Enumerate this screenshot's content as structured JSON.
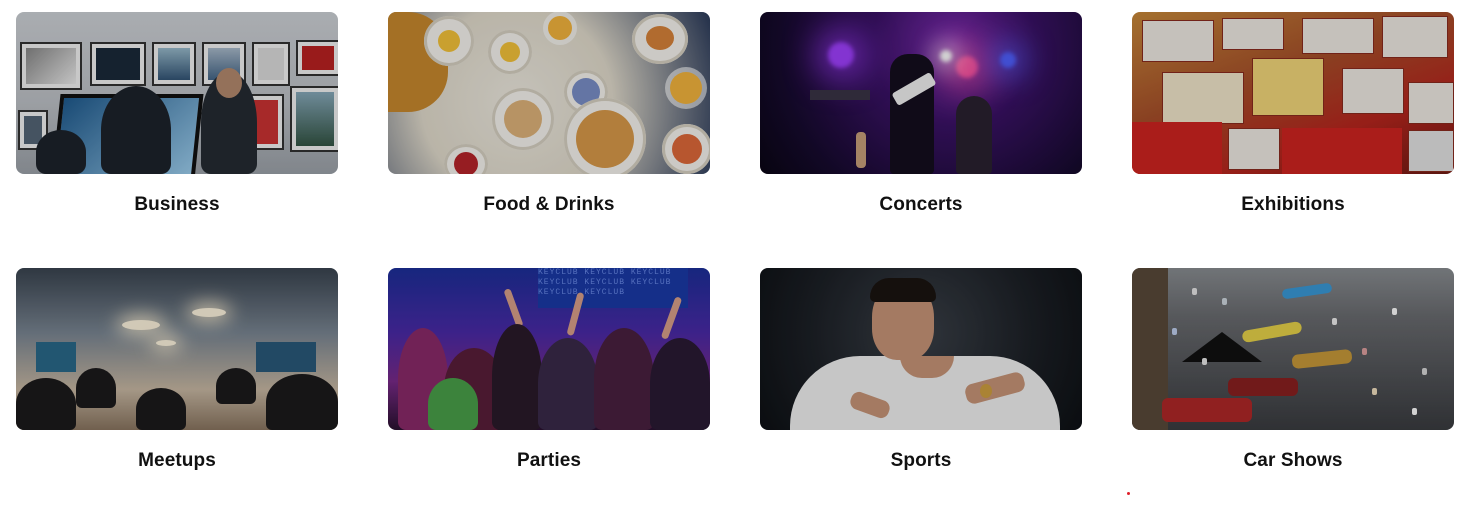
{
  "categories": [
    {
      "label": "Business"
    },
    {
      "label": "Food & Drinks"
    },
    {
      "label": "Concerts"
    },
    {
      "label": "Exhibitions"
    },
    {
      "label": "Meetups"
    },
    {
      "label": "Parties"
    },
    {
      "label": "Sports"
    },
    {
      "label": "Car Shows"
    }
  ],
  "colors": {
    "label_text": "#111111",
    "accent_dot": "#e0202a"
  }
}
